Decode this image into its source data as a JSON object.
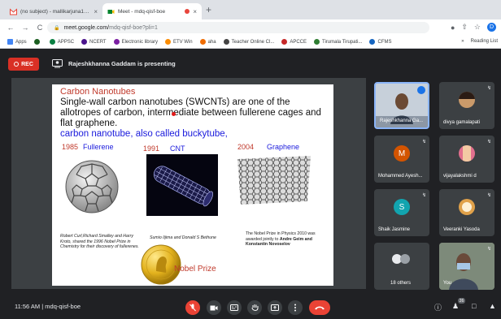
{
  "browser": {
    "tabs": [
      {
        "label": "(no subject) - mallikarjuna18...",
        "close": "×"
      },
      {
        "label": "Meet - mdq-qisf-boe",
        "close": "×"
      }
    ],
    "new_tab": "+",
    "nav": {
      "back": "←",
      "forward": "→",
      "reload": "C",
      "home": "⌂"
    },
    "url": {
      "host": "meet.google.com/",
      "path": "mdq-qisf-boe?pli=1"
    },
    "profile_initial": "D",
    "bookmarks": [
      "Apps",
      "APPSC",
      "NCERT",
      "Electronic library",
      "ETV Win",
      "aha",
      "Teacher Online Cl...",
      "APCCE",
      "Tirumala Tirupati...",
      "CFMS"
    ],
    "reading_list": "Reading List",
    "bookmark_colors": [
      "#4285f4",
      "#1b5e20",
      "#0b8043",
      "#4a148c",
      "#7b1fa2",
      "#fb8c00",
      "#ef6c00",
      "#444444",
      "#c62828",
      "#2e7d32",
      "#1565c0"
    ]
  },
  "meet": {
    "rec_label": "REC",
    "presenting_text": "Rajeshkhanna Gaddam is presenting",
    "slide": {
      "title": "Carbon Nanotubes",
      "body": "Single-wall carbon nanotubes (SWCNTs) are one of the allotropes of carbon, intermediate between fullerene cages and flat graphene.",
      "blue_line": "carbon nanotube, also called buckytube,",
      "items": [
        {
          "year": "1985",
          "name": "Fullerene"
        },
        {
          "year": "1991",
          "name": "CNT"
        },
        {
          "year": "2004",
          "name": "Graphene"
        }
      ],
      "caption_fullerene": "Robert Curl,Richard Smalley and Harry Kroto, shared the 1996 Nobel Prize in Chemistry for their discovery of fullerenes.",
      "caption_cnt": "Sumio Iijima and Donald S Bethune",
      "caption_graphene_plain": "The Nobel Prize in Physics 2010 was awarded jointly to",
      "caption_graphene_bold": "Andre Geim and Konstantin Novoselov",
      "nobel_label": "Nobel Prize"
    },
    "participants": [
      {
        "name": "Rajeshkhanna Ga..."
      },
      {
        "name": "divya gamalapati"
      },
      {
        "name": "Mohammed Ayesh...",
        "initial": "M",
        "color": "#d35400"
      },
      {
        "name": "vijayalakshmi d"
      },
      {
        "name": "Shaik Jasmine",
        "initial": "S",
        "color": "#12a4af"
      },
      {
        "name": "Veeranki Yasoda"
      },
      {
        "name": "18 others"
      },
      {
        "name": "You"
      }
    ],
    "others_count": "26",
    "bottom": {
      "time": "11:56 AM",
      "separator": "|",
      "meeting_code": "mdq-qisf-boe"
    }
  }
}
